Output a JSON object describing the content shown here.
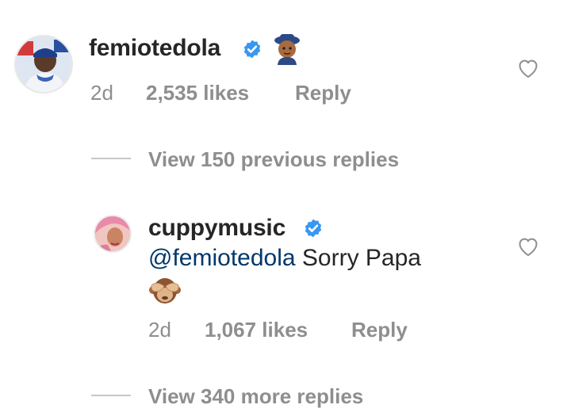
{
  "comment": {
    "username": "femiotedola",
    "verified": true,
    "emoji_icon": "cowboy-man-emoji-icon",
    "age": "2d",
    "likes": "2,535 likes",
    "reply_label": "Reply"
  },
  "view_previous": {
    "label": "View 150 previous replies"
  },
  "reply": {
    "username": "cuppymusic",
    "verified": true,
    "mention": "@femiotedola",
    "text": "Sorry Papa",
    "emoji_icon": "see-no-evil-monkey-emoji-icon",
    "age": "2d",
    "likes": "1,067 likes",
    "reply_label": "Reply"
  },
  "view_more": {
    "label": "View 340 more replies"
  },
  "colors": {
    "verified_blue": "#3897f0",
    "meta_gray": "#8e8e8e",
    "mention_blue": "#00376b",
    "text": "#262626"
  }
}
